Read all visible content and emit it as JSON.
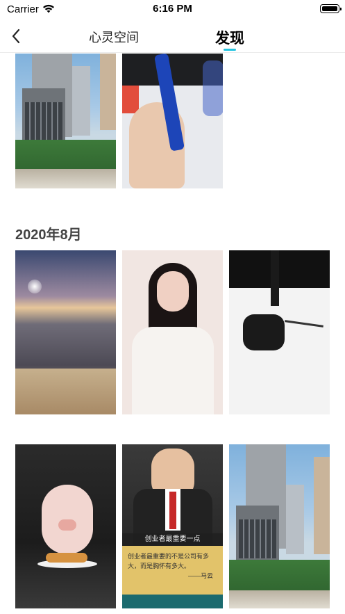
{
  "status_bar": {
    "carrier": "Carrier",
    "time": "6:16 PM",
    "icons": [
      "wifi-icon",
      "battery-icon"
    ]
  },
  "nav": {
    "back_icon": "chevron-left-icon",
    "tabs": [
      {
        "label": "心灵空间",
        "active": false
      },
      {
        "label": "发现",
        "active": true
      }
    ],
    "accent_color": "#24c4e0"
  },
  "sections": [
    {
      "title": "",
      "items": [
        "city-buildings-photo",
        "hand-holding-pen-photo"
      ]
    },
    {
      "title": "2020年8月",
      "items": [
        "sunset-sky-photo",
        "woman-speaking-video",
        "desk-earbuds-photo"
      ]
    },
    {
      "title": "",
      "items": [
        "piglet-bread-video",
        "speaker-subtitle-video",
        "city-buildings-photo"
      ]
    }
  ],
  "subtitles": {
    "banner": "创业者最重要一点",
    "caption_line1": "创业者最重要的不是公司有多",
    "caption_line2": "大，而是胸怀有多大。",
    "caption_sign": "——马云"
  }
}
